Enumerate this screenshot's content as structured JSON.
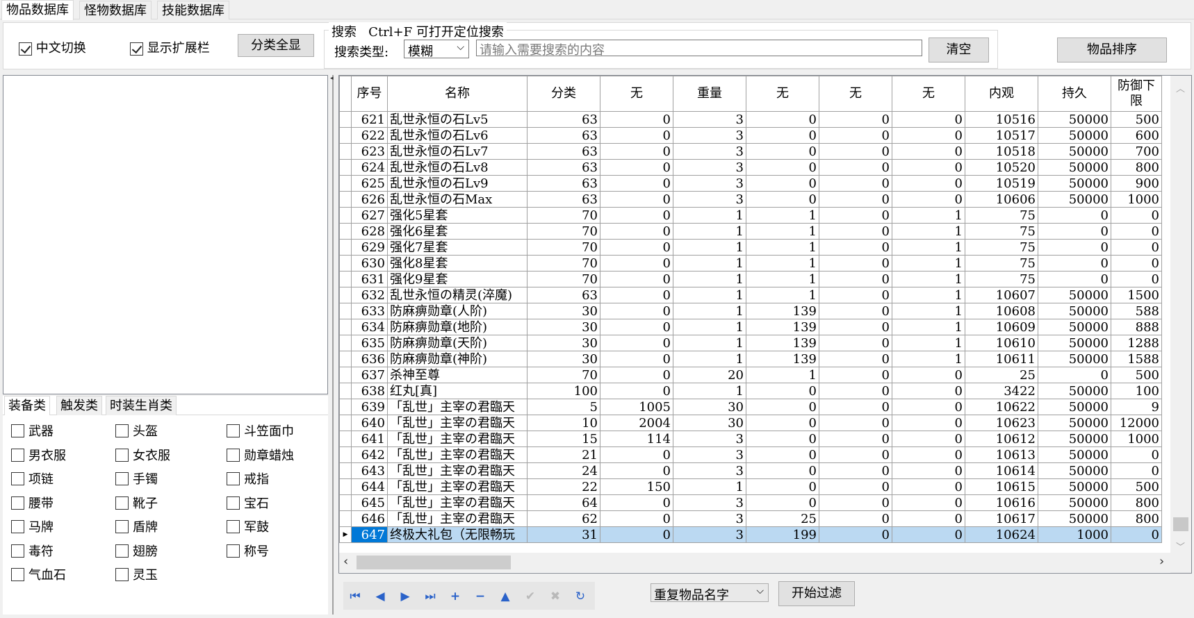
{
  "top_tabs": [
    "物品数据库",
    "怪物数据库",
    "技能数据库"
  ],
  "toolbar": {
    "cn_switch": "中文切换",
    "show_ext": "显示扩展栏",
    "show_all": "分类全显",
    "search_group": "搜索",
    "search_hint": "Ctrl+F 可打开定位搜索",
    "search_type_label": "搜索类型:",
    "search_type_value": "模糊",
    "search_placeholder": "请输入需要搜索的内容",
    "clear": "清空",
    "sort": "物品排序"
  },
  "category_tabs": [
    "装备类",
    "触发类",
    "时装生肖类"
  ],
  "categories": [
    "武器",
    "头盔",
    "斗笠面巾",
    "男衣服",
    "女衣服",
    "勋章蜡烛",
    "项链",
    "手镯",
    "戒指",
    "腰带",
    "靴子",
    "宝石",
    "马牌",
    "盾牌",
    "军鼓",
    "毒符",
    "翅膀",
    "称号",
    "气血石",
    "灵玉"
  ],
  "table": {
    "columns": [
      "序号",
      "名称",
      "分类",
      "无",
      "重量",
      "无",
      "无",
      "无",
      "内观",
      "持久",
      "防御下限"
    ],
    "rows": [
      [
        "621",
        "乱世永恒の石Lv5",
        "63",
        "0",
        "3",
        "0",
        "0",
        "0",
        "10516",
        "50000",
        "500"
      ],
      [
        "622",
        "乱世永恒の石Lv6",
        "63",
        "0",
        "3",
        "0",
        "0",
        "0",
        "10517",
        "50000",
        "600"
      ],
      [
        "623",
        "乱世永恒の石Lv7",
        "63",
        "0",
        "3",
        "0",
        "0",
        "0",
        "10518",
        "50000",
        "700"
      ],
      [
        "624",
        "乱世永恒の石Lv8",
        "63",
        "0",
        "3",
        "0",
        "0",
        "0",
        "10520",
        "50000",
        "800"
      ],
      [
        "625",
        "乱世永恒の石Lv9",
        "63",
        "0",
        "3",
        "0",
        "0",
        "0",
        "10519",
        "50000",
        "900"
      ],
      [
        "626",
        "乱世永恒の石Max",
        "63",
        "0",
        "3",
        "0",
        "0",
        "0",
        "10606",
        "50000",
        "1000"
      ],
      [
        "627",
        "强化5星套",
        "70",
        "0",
        "1",
        "1",
        "0",
        "1",
        "75",
        "0",
        "0"
      ],
      [
        "628",
        "强化6星套",
        "70",
        "0",
        "1",
        "1",
        "0",
        "1",
        "75",
        "0",
        "0"
      ],
      [
        "629",
        "强化7星套",
        "70",
        "0",
        "1",
        "1",
        "0",
        "1",
        "75",
        "0",
        "0"
      ],
      [
        "630",
        "强化8星套",
        "70",
        "0",
        "1",
        "1",
        "0",
        "1",
        "75",
        "0",
        "0"
      ],
      [
        "631",
        "强化9星套",
        "70",
        "0",
        "1",
        "1",
        "0",
        "1",
        "75",
        "0",
        "0"
      ],
      [
        "632",
        "乱世永恒の精灵(淬魔)",
        "63",
        "0",
        "1",
        "1",
        "0",
        "1",
        "10607",
        "50000",
        "1500"
      ],
      [
        "633",
        "防麻痹勋章(人阶)",
        "30",
        "0",
        "1",
        "139",
        "0",
        "1",
        "10608",
        "50000",
        "588"
      ],
      [
        "634",
        "防麻痹勋章(地阶)",
        "30",
        "0",
        "1",
        "139",
        "0",
        "1",
        "10609",
        "50000",
        "888"
      ],
      [
        "635",
        "防麻痹勋章(天阶)",
        "30",
        "0",
        "1",
        "139",
        "0",
        "1",
        "10610",
        "50000",
        "1288"
      ],
      [
        "636",
        "防麻痹勋章(神阶)",
        "30",
        "0",
        "1",
        "139",
        "0",
        "1",
        "10611",
        "50000",
        "1588"
      ],
      [
        "637",
        "杀神至尊",
        "70",
        "0",
        "20",
        "1",
        "0",
        "0",
        "25",
        "0",
        "500"
      ],
      [
        "638",
        "红丸[真]",
        "100",
        "0",
        "1",
        "0",
        "0",
        "0",
        "3422",
        "50000",
        "100"
      ],
      [
        "639",
        "「乱世」主宰の君臨天",
        "5",
        "1005",
        "30",
        "0",
        "0",
        "0",
        "10622",
        "50000",
        "9"
      ],
      [
        "640",
        "「乱世」主宰の君臨天",
        "10",
        "2004",
        "30",
        "0",
        "0",
        "0",
        "10623",
        "50000",
        "12000"
      ],
      [
        "641",
        "「乱世」主宰の君臨天",
        "15",
        "114",
        "3",
        "0",
        "0",
        "0",
        "10612",
        "50000",
        "1000"
      ],
      [
        "642",
        "「乱世」主宰の君臨天",
        "21",
        "0",
        "3",
        "0",
        "0",
        "0",
        "10613",
        "50000",
        "0"
      ],
      [
        "643",
        "「乱世」主宰の君臨天",
        "24",
        "0",
        "3",
        "0",
        "0",
        "0",
        "10614",
        "50000",
        "0"
      ],
      [
        "644",
        "「乱世」主宰の君臨天",
        "22",
        "150",
        "1",
        "0",
        "0",
        "0",
        "10615",
        "50000",
        "500"
      ],
      [
        "645",
        "「乱世」主宰の君臨天",
        "64",
        "0",
        "3",
        "0",
        "0",
        "0",
        "10616",
        "50000",
        "800"
      ],
      [
        "646",
        "「乱世」主宰の君臨天",
        "62",
        "0",
        "3",
        "25",
        "0",
        "0",
        "10617",
        "50000",
        "800"
      ],
      [
        "647",
        "终极大礼包（无限畅玩",
        "31",
        "0",
        "3",
        "199",
        "0",
        "0",
        "10624",
        "1000",
        "0"
      ]
    ],
    "selected_row": "647"
  },
  "bottom": {
    "filter_select": "重复物品名字",
    "filter_button": "开始过滤"
  }
}
